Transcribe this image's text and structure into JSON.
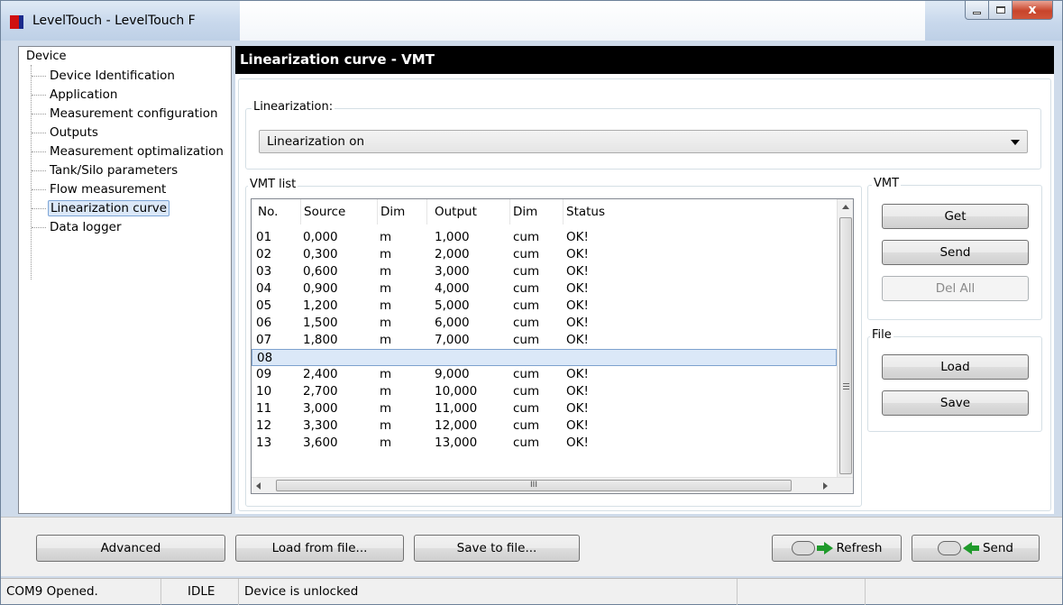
{
  "window": {
    "title": "LevelTouch - LevelTouch F",
    "close_glyph": "x"
  },
  "tree": {
    "root": "Device",
    "items": [
      {
        "label": "Device Identification",
        "selected": false
      },
      {
        "label": "Application",
        "selected": false
      },
      {
        "label": "Measurement configuration",
        "selected": false
      },
      {
        "label": "Outputs",
        "selected": false
      },
      {
        "label": "Measurement optimalization",
        "selected": false
      },
      {
        "label": "Tank/Silo parameters",
        "selected": false
      },
      {
        "label": "Flow measurement",
        "selected": false
      },
      {
        "label": "Linearization curve",
        "selected": true
      },
      {
        "label": "Data logger",
        "selected": false
      }
    ]
  },
  "main": {
    "header": "Linearization curve - VMT",
    "linearization": {
      "group_label": "Linearization:",
      "selected_value": "Linearization on"
    },
    "vmt_list": {
      "group_label": "VMT list",
      "columns": [
        "No.",
        "Source",
        "Dim",
        "Output",
        "Dim",
        "Status"
      ],
      "rows": [
        [
          "01",
          "0,000",
          "m",
          "1,000",
          "cum",
          "OK!"
        ],
        [
          "02",
          "0,300",
          "m",
          "2,000",
          "cum",
          "OK!"
        ],
        [
          "03",
          "0,600",
          "m",
          "3,000",
          "cum",
          "OK!"
        ],
        [
          "04",
          "0,900",
          "m",
          "4,000",
          "cum",
          "OK!"
        ],
        [
          "05",
          "1,200",
          "m",
          "5,000",
          "cum",
          "OK!"
        ],
        [
          "06",
          "1,500",
          "m",
          "6,000",
          "cum",
          "OK!"
        ],
        [
          "07",
          "1,800",
          "m",
          "7,000",
          "cum",
          "OK!"
        ],
        [
          "08",
          "",
          "",
          "",
          "",
          ""
        ],
        [
          "09",
          "2,400",
          "m",
          "9,000",
          "cum",
          "OK!"
        ],
        [
          "10",
          "2,700",
          "m",
          "10,000",
          "cum",
          "OK!"
        ],
        [
          "11",
          "3,000",
          "m",
          "11,000",
          "cum",
          "OK!"
        ],
        [
          "12",
          "3,300",
          "m",
          "12,000",
          "cum",
          "OK!"
        ],
        [
          "13",
          "3,600",
          "m",
          "13,000",
          "cum",
          "OK!"
        ]
      ],
      "selected_row": "08",
      "hscroll_grip": "III"
    },
    "vmt_group": {
      "label": "VMT",
      "get": "Get",
      "send": "Send",
      "del_all": "Del All"
    },
    "file_group": {
      "label": "File",
      "load": "Load",
      "save": "Save"
    }
  },
  "bottom": {
    "advanced": "Advanced",
    "load_from_file": "Load from file...",
    "save_to_file": "Save to file...",
    "refresh": "Refresh",
    "send": "Send"
  },
  "status": {
    "port": "COM9 Opened.",
    "state": "IDLE",
    "lock": "Device is unlocked"
  },
  "colors": {
    "header_bg": "#000000",
    "selection": "#dbe8f8",
    "arrow_green": "#1f9a2b",
    "close_red": "#c8442b"
  },
  "icons": [
    "app-icon",
    "minimize-icon",
    "maximize-icon",
    "close-icon",
    "dropdown-arrow-icon",
    "cloud-icon",
    "arrow-right-icon",
    "arrow-left-icon"
  ]
}
